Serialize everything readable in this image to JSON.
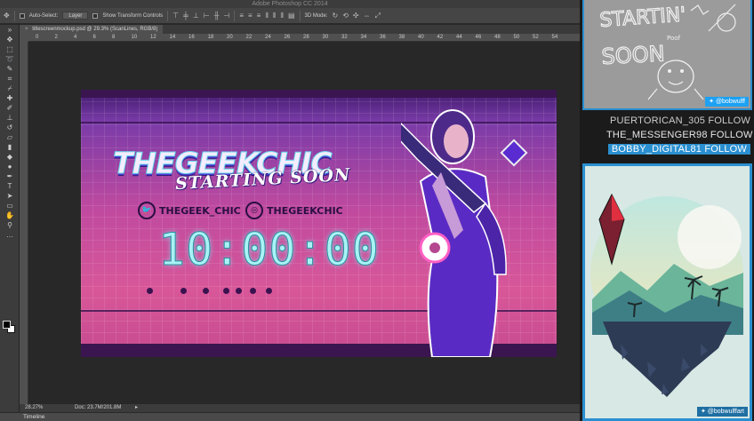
{
  "window": {
    "title": "Adobe Photoshop CC 2014"
  },
  "options_bar": {
    "auto_select_label": "Auto-Select:",
    "auto_select_value": "Layer",
    "transform_label": "Show Transform Controls",
    "mode_3d_label": "3D Mode:"
  },
  "document": {
    "tab_title": "titlescreenmockup.psd @ 29.3% (ScanLines, RGB/8)",
    "ruler_ticks": [
      "0",
      "2",
      "4",
      "6",
      "8",
      "10",
      "12",
      "14",
      "16",
      "18",
      "20",
      "22",
      "24",
      "26",
      "28",
      "30",
      "32",
      "34",
      "36",
      "38",
      "40",
      "42",
      "44",
      "46",
      "48",
      "50",
      "52",
      "54"
    ]
  },
  "status": {
    "zoom": "28.27%",
    "doc_size": "Doc: 23.7M/201.8M"
  },
  "timeline": {
    "label": "Timeline"
  },
  "artwork": {
    "brand": "THEGEEKCHIC",
    "subtitle": "STARTING SOON",
    "twitter_handle": "THEGEEK_CHIC",
    "instagram_handle": "THEGEEKCHIC",
    "timer": "10:00:00"
  },
  "overlay": {
    "sketch_text_1": "STARTIN'",
    "sketch_text_2": "SOON",
    "sketch_small": "Poof",
    "sketch_credit": "@bobwulff",
    "followers": [
      "PUERTORICAN_305  FOLLOW",
      "THE_MESSENGER98  FOLLOW",
      "BOBBY_DIGITAL81  FOLLOW"
    ],
    "art_credit": "@bobwulffart"
  },
  "colors": {
    "accent_blue": "#2a8fd0",
    "twitter_blue": "#1da1f2",
    "timer_cyan": "#a9f3f5",
    "doc_pink": "#d85799",
    "doc_purple": "#3a1550"
  }
}
